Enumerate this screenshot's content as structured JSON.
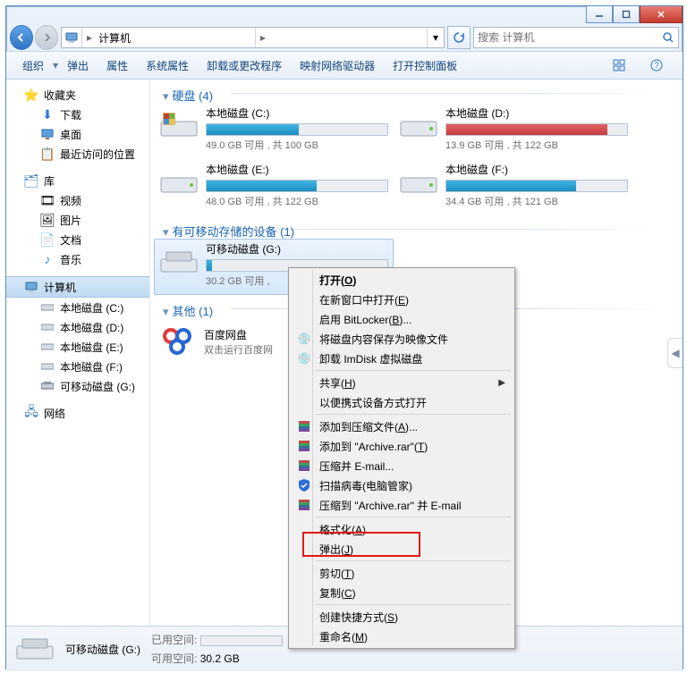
{
  "address": {
    "crumb1": "计算机",
    "sep": "▶"
  },
  "search": {
    "placeholder": "搜索 计算机"
  },
  "toolbar": {
    "org": "组织",
    "eject": "弹出",
    "prop": "属性",
    "sysprop": "系统属性",
    "uninstall": "卸载或更改程序",
    "netdrv": "映射网络驱动器",
    "cpanel": "打开控制面板"
  },
  "side": {
    "fav": "收藏夹",
    "dl": "下载",
    "desk": "桌面",
    "recent": "最近访问的位置",
    "lib": "库",
    "video": "视频",
    "pic": "图片",
    "doc": "文档",
    "music": "音乐",
    "computer": "计算机",
    "c": "本地磁盘 (C:)",
    "d": "本地磁盘 (D:)",
    "e": "本地磁盘 (E:)",
    "f": "本地磁盘 (F:)",
    "g": "可移动磁盘 (G:)",
    "net": "网络"
  },
  "sections": {
    "hdd": "硬盘 (4)",
    "rem": "有可移动存储的设备 (1)",
    "other": "其他 (1)"
  },
  "drives": {
    "c": {
      "nm": "本地磁盘 (C:)",
      "sz": "49.0 GB 可用 , 共 100 GB"
    },
    "d": {
      "nm": "本地磁盘 (D:)",
      "sz": "13.9 GB 可用 , 共 122 GB"
    },
    "e": {
      "nm": "本地磁盘 (E:)",
      "sz": "48.0 GB 可用 , 共 122 GB"
    },
    "f": {
      "nm": "本地磁盘 (F:)",
      "sz": "34.4 GB 可用 , 共 121 GB"
    },
    "g": {
      "nm": "可移动磁盘 (G:)",
      "sz": "30.2 GB 可用 ,"
    }
  },
  "baidu": {
    "nm": "百度网盘",
    "sub": "双击运行百度网"
  },
  "menu": {
    "open": "打开(O)",
    "newwin": "在新窗口中打开(E)",
    "bitlocker": "启用 BitLocker(B)...",
    "saveimg": "将磁盘内容保存为映像文件",
    "imdisk": "卸载 ImDisk 虚拟磁盘",
    "share": "共享(H)",
    "portable": "以便携式设备方式打开",
    "addarc": "添加到压缩文件(A)...",
    "addrar": "添加到 \"Archive.rar\"(T)",
    "zipmail": "压缩并 E-mail...",
    "scan": "扫描病毒(电脑管家)",
    "zipmail2": "压缩到 \"Archive.rar\" 并 E-mail",
    "format": "格式化(A)...",
    "eject": "弹出(J)",
    "cut": "剪切(T)",
    "copy": "复制(C)",
    "shortcut": "创建快捷方式(S)",
    "rename": "重命名(M)"
  },
  "status": {
    "title": "可移动磁盘 (G:)",
    "used": "已用空间:",
    "free": "可用空间:",
    "freev": "30.2 GB"
  }
}
